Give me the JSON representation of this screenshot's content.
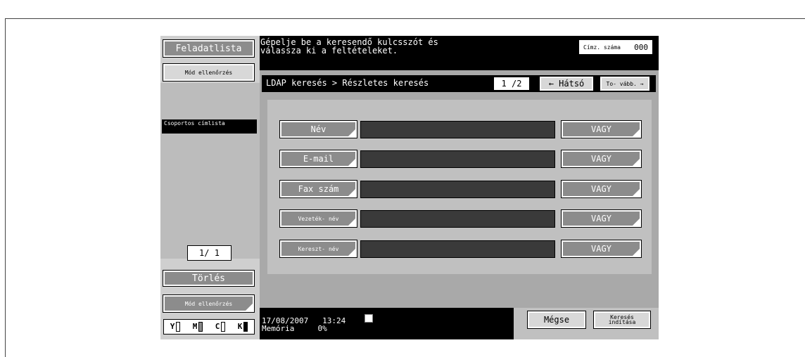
{
  "left": {
    "job_list": "Feladatlista",
    "mode_check": "Mód ellenőrzés",
    "group_list": "Csoportos címlista",
    "page": "1/ 1",
    "delete": "Törlés",
    "mode_check2": "Mód ellenőrzés"
  },
  "header": {
    "message_line1": "Gépelje be a keresendő kulcsszót és",
    "message_line2": "válassza ki a feltételeket.",
    "counter_label": "Címz. száma",
    "counter_value": "000"
  },
  "tab": {
    "title": "LDAP keresés > Részletes keresés",
    "page": "1 /2",
    "back": "← Hátsó",
    "next": "To- vább. →"
  },
  "rows": [
    {
      "label": "Név",
      "op": "VAGY"
    },
    {
      "label": "E-mail",
      "op": "VAGY"
    },
    {
      "label": "Fax szám",
      "op": "VAGY"
    },
    {
      "label": "Vezeték- név",
      "op": "VAGY"
    },
    {
      "label": "Kereszt- név",
      "op": "VAGY"
    }
  ],
  "status": {
    "date": "17/08/2007",
    "time": "13:24",
    "memory_label": "Memória",
    "memory_value": "0%"
  },
  "buttons": {
    "cancel": "Mégse",
    "start": "Keresés indítása"
  },
  "toner": [
    "Y",
    "M",
    "C",
    "K"
  ]
}
